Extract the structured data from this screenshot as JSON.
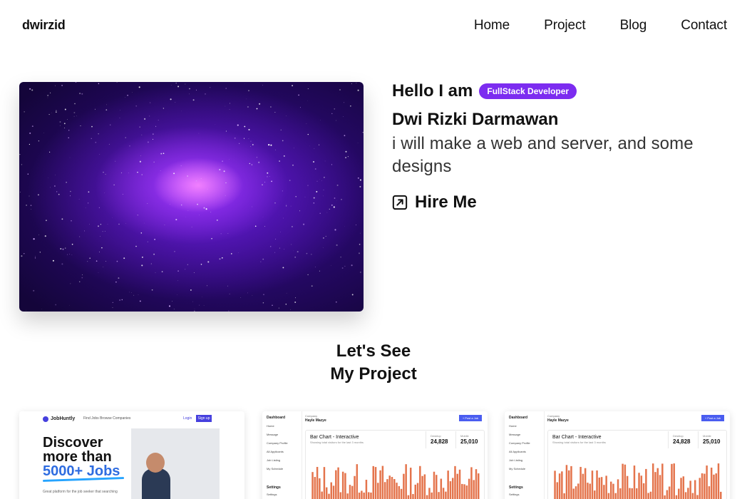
{
  "nav": {
    "brand": "dwirzid",
    "items": [
      "Home",
      "Project",
      "Blog",
      "Contact"
    ]
  },
  "hero": {
    "greeting": "Hello I am",
    "badge": "FullStack Developer",
    "name": "Dwi Rizki Darmawan",
    "tagline": "i will make a web and server, and some designs",
    "cta": "Hire Me",
    "cta_icon": "arrow-up-right-square-icon",
    "image": "purple-galaxy"
  },
  "projects": {
    "title_line1": "Let's See",
    "title_line2": "My Project",
    "cards": [
      {
        "kind": "landing",
        "brand": "JobHuntly",
        "links": "Find Jobs   Browse Companies",
        "login": "Login",
        "signup": "Sign up",
        "headline_1": "Discover",
        "headline_2": "more than",
        "headline_3": "5000+ Jobs",
        "subtitle": "Great platform for the job seeker that searching"
      },
      {
        "kind": "dashboard",
        "sidebar_title": "Dashboard",
        "sidebar_items": [
          "Home",
          "Message",
          "Company Profile",
          "All Applicants",
          "Job Listing",
          "My Schedule"
        ],
        "settings_label": "Settings",
        "settings_item": "Settings",
        "company_label": "Company",
        "company_name": "Hayle Mazye",
        "button": "+ Post a Job",
        "chart_title": "Bar Chart - Interactive",
        "chart_desc": "Showing total visitors for the last 3 months",
        "stat1_label": "Desktop",
        "stat1_value": "24,828",
        "stat2_label": "Mobile",
        "stat2_value": "25,010"
      },
      {
        "kind": "dashboard",
        "sidebar_title": "Dashboard",
        "sidebar_items": [
          "Home",
          "Message",
          "Company Profile",
          "All Applicants",
          "Job Listing",
          "My Schedule"
        ],
        "settings_label": "Settings",
        "settings_item": "Settings",
        "company_label": "Company",
        "company_name": "Hayle Mazye",
        "button": "+ Post a Job",
        "chart_title": "Bar Chart - Interactive",
        "chart_desc": "Showing total visitors for the last 3 months",
        "stat1_label": "Desktop",
        "stat1_value": "24,828",
        "stat2_label": "Mobile",
        "stat2_value": "25,010"
      }
    ]
  },
  "colors": {
    "accent": "#7c2cf0",
    "bar": "#e4744c",
    "primary_blue": "#4a5df0"
  }
}
